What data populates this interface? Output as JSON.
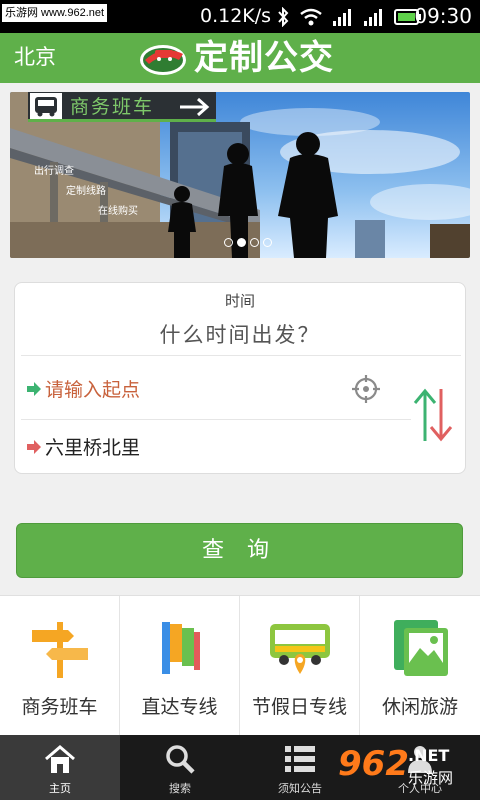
{
  "status_bar": {
    "watermark": "乐游网 www.962.net",
    "net_speed": "0.12K/s",
    "time": "09:30",
    "icons": [
      "bluetooth-icon",
      "wifi-icon",
      "signal-icon",
      "signal-icon",
      "battery-icon"
    ]
  },
  "header": {
    "city": "北京",
    "title": "定制公交"
  },
  "banner": {
    "tag": "商务班车",
    "lines": [
      "出行调查",
      "定制线路",
      "在线购买"
    ],
    "page_count": 4,
    "active_page": 2
  },
  "trip_form": {
    "time_label": "时间",
    "time_placeholder": "什么时间出发？",
    "start_placeholder": "请输入起点",
    "end_value": "六里桥北里"
  },
  "query_button": "查 询",
  "categories": [
    {
      "label": "商务班车",
      "icon": "signpost-icon"
    },
    {
      "label": "直达专线",
      "icon": "flag-icon"
    },
    {
      "label": "节假日专线",
      "icon": "holiday-bus-icon"
    },
    {
      "label": "休闲旅游",
      "icon": "gallery-icon"
    }
  ],
  "bottom_nav": [
    {
      "label": "主页",
      "icon": "home-icon",
      "active": true
    },
    {
      "label": "搜索",
      "icon": "search-icon"
    },
    {
      "label": "须知公告",
      "icon": "list-icon"
    },
    {
      "label": "个人中心",
      "icon": "person-icon"
    }
  ],
  "watermark_corner": {
    "num": "962",
    "net": ".NET",
    "site": "乐游网"
  },
  "colors": {
    "brand_green": "#5fb04a",
    "start_text": "#c8613b",
    "nav_bg": "#1a1a1a"
  }
}
